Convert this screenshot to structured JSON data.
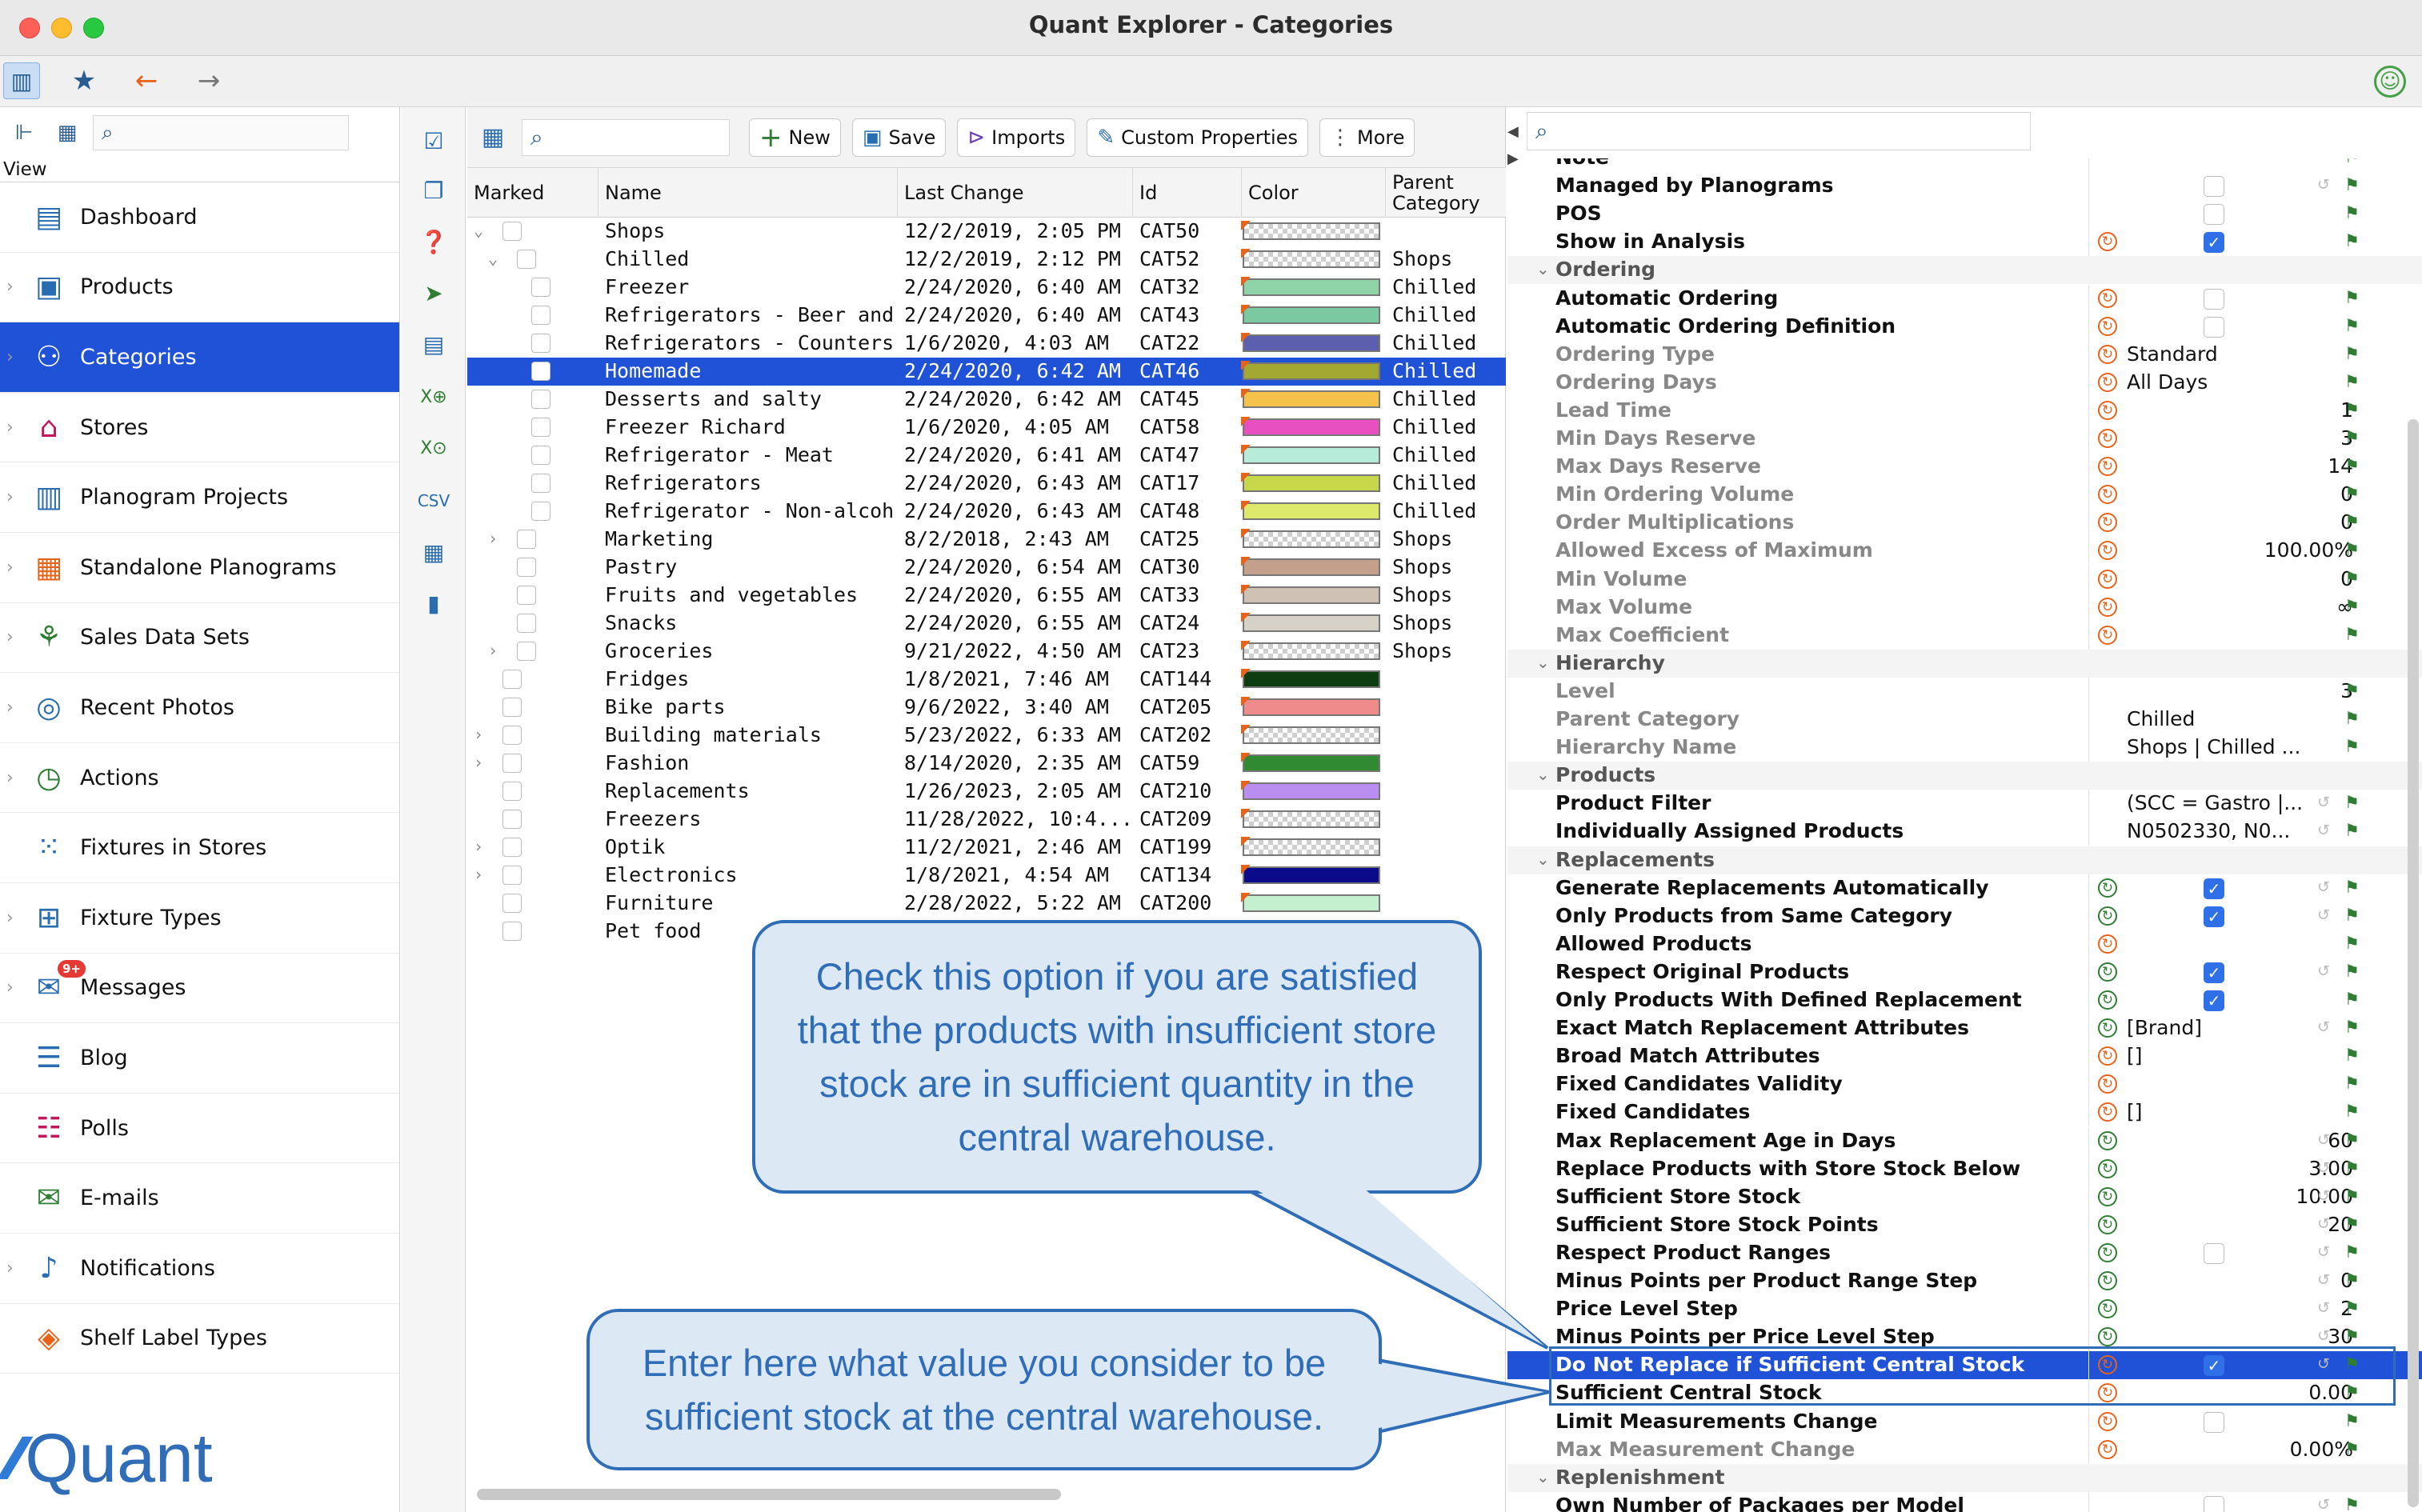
{
  "window": {
    "title": "Quant Explorer - Categories"
  },
  "sidebar": {
    "view_label": "View",
    "search_placeholder": "",
    "items": [
      {
        "label": "Dashboard",
        "icon": "dashboard-icon"
      },
      {
        "label": "Products",
        "icon": "product-icon"
      },
      {
        "label": "Categories",
        "icon": "categories-icon"
      },
      {
        "label": "Stores",
        "icon": "store-icon"
      },
      {
        "label": "Planogram Projects",
        "icon": "planogram-projects-icon"
      },
      {
        "label": "Standalone Planograms",
        "icon": "planogram-icon"
      },
      {
        "label": "Sales Data Sets",
        "icon": "sales-data-icon"
      },
      {
        "label": "Recent Photos",
        "icon": "camera-icon"
      },
      {
        "label": "Actions",
        "icon": "actions-icon"
      },
      {
        "label": "Fixtures in Stores",
        "icon": "fixtures-icon"
      },
      {
        "label": "Fixture Types",
        "icon": "fixture-types-icon"
      },
      {
        "label": "Messages",
        "icon": "messages-icon",
        "badge": "9+"
      },
      {
        "label": "Blog",
        "icon": "blog-icon"
      },
      {
        "label": "Polls",
        "icon": "polls-icon"
      },
      {
        "label": "E-mails",
        "icon": "email-icon"
      },
      {
        "label": "Notifications",
        "icon": "bell-icon"
      },
      {
        "label": "Shelf Label Types",
        "icon": "shelf-label-icon"
      }
    ],
    "brand": "Quant"
  },
  "middle": {
    "toolbar": {
      "new": "New",
      "save": "Save",
      "imports": "Imports",
      "custom_properties": "Custom Properties",
      "more": "More"
    },
    "columns": [
      "Marked",
      "Name",
      "Last Change",
      "Id",
      "Color",
      "Parent Category"
    ],
    "rows": [
      {
        "name": "Shops",
        "last_change": "12/2/2019, 2:05 PM",
        "id": "CAT50",
        "color": "checker",
        "parent": "",
        "indent": 0,
        "exp": "open"
      },
      {
        "name": "Chilled",
        "last_change": "12/2/2019, 2:12 PM",
        "id": "CAT52",
        "color": "checker",
        "parent": "Shops",
        "indent": 1,
        "exp": "open"
      },
      {
        "name": "Freezer",
        "last_change": "2/24/2020, 6:40 AM",
        "id": "CAT32",
        "color": "#8fd4a8",
        "parent": "Chilled",
        "indent": 2,
        "exp": ""
      },
      {
        "name": "Refrigerators - Beer and ci...",
        "last_change": "2/24/2020, 6:40 AM",
        "id": "CAT43",
        "color": "#7bc9a0",
        "parent": "Chilled",
        "indent": 2,
        "exp": ""
      },
      {
        "name": "Refrigerators - Counters",
        "last_change": "1/6/2020, 4:03 AM",
        "id": "CAT22",
        "color": "#5b5fae",
        "parent": "Chilled",
        "indent": 2,
        "exp": ""
      },
      {
        "name": "Homemade",
        "last_change": "2/24/2020, 6:42 AM",
        "id": "CAT46",
        "color": "#a3a832",
        "parent": "Chilled",
        "indent": 2,
        "exp": "",
        "selected": true
      },
      {
        "name": "Desserts and salty",
        "last_change": "2/24/2020, 6:42 AM",
        "id": "CAT45",
        "color": "#f5c24a",
        "parent": "Chilled",
        "indent": 2,
        "exp": ""
      },
      {
        "name": "Freezer Richard",
        "last_change": "1/6/2020, 4:05 AM",
        "id": "CAT58",
        "color": "#e84fc0",
        "parent": "Chilled",
        "indent": 2,
        "exp": ""
      },
      {
        "name": "Refrigerator - Meat",
        "last_change": "2/24/2020, 6:41 AM",
        "id": "CAT47",
        "color": "#b6ecd9",
        "parent": "Chilled",
        "indent": 2,
        "exp": ""
      },
      {
        "name": "Refrigerators",
        "last_change": "2/24/2020, 6:43 AM",
        "id": "CAT17",
        "color": "#c6d84a",
        "parent": "Chilled",
        "indent": 2,
        "exp": ""
      },
      {
        "name": "Refrigerator - Non-alcoholic",
        "last_change": "2/24/2020, 6:43 AM",
        "id": "CAT48",
        "color": "#dce96a",
        "parent": "Chilled",
        "indent": 2,
        "exp": ""
      },
      {
        "name": "Marketing",
        "last_change": "8/2/2018, 2:43 AM",
        "id": "CAT25",
        "color": "checker",
        "parent": "Shops",
        "indent": 1,
        "exp": "closed"
      },
      {
        "name": "Pastry",
        "last_change": "2/24/2020, 6:54 AM",
        "id": "CAT30",
        "color": "#c4a08c",
        "parent": "Shops",
        "indent": 1,
        "exp": ""
      },
      {
        "name": "Fruits and vegetables",
        "last_change": "2/24/2020, 6:55 AM",
        "id": "CAT33",
        "color": "#cfc1b3",
        "parent": "Shops",
        "indent": 1,
        "exp": ""
      },
      {
        "name": "Snacks",
        "last_change": "2/24/2020, 6:55 AM",
        "id": "CAT24",
        "color": "#d6d2c7",
        "parent": "Shops",
        "indent": 1,
        "exp": ""
      },
      {
        "name": "Groceries",
        "last_change": "9/21/2022, 4:50 AM",
        "id": "CAT23",
        "color": "checker",
        "parent": "Shops",
        "indent": 1,
        "exp": "closed"
      },
      {
        "name": "Fridges",
        "last_change": "1/8/2021, 7:46 AM",
        "id": "CAT144",
        "color": "#0e3d12",
        "parent": "",
        "indent": 0,
        "exp": ""
      },
      {
        "name": "Bike parts",
        "last_change": "9/6/2022, 3:40 AM",
        "id": "CAT205",
        "color": "#ef8b8b",
        "parent": "",
        "indent": 0,
        "exp": ""
      },
      {
        "name": "Building materials",
        "last_change": "5/23/2022, 6:33 AM",
        "id": "CAT202",
        "color": "checker",
        "parent": "",
        "indent": 0,
        "exp": "closed"
      },
      {
        "name": "Fashion",
        "last_change": "8/14/2020, 2:35 AM",
        "id": "CAT59",
        "color": "#2f8a32",
        "parent": "",
        "indent": 0,
        "exp": "closed"
      },
      {
        "name": "Replacements",
        "last_change": "1/26/2023, 2:05 AM",
        "id": "CAT210",
        "color": "#b98ef0",
        "parent": "",
        "indent": 0,
        "exp": ""
      },
      {
        "name": "Freezers",
        "last_change": "11/28/2022, 10:4...",
        "id": "CAT209",
        "color": "checker",
        "parent": "",
        "indent": 0,
        "exp": ""
      },
      {
        "name": "Optik",
        "last_change": "11/2/2021, 2:46 AM",
        "id": "CAT199",
        "color": "checker",
        "parent": "",
        "indent": 0,
        "exp": "closed"
      },
      {
        "name": "Electronics",
        "last_change": "1/8/2021, 4:54 AM",
        "id": "CAT134",
        "color": "#0a0a8a",
        "parent": "",
        "indent": 0,
        "exp": "closed"
      },
      {
        "name": "Furniture",
        "last_change": "2/28/2022, 5:22 AM",
        "id": "CAT200",
        "color": "#c5f0cf",
        "parent": "",
        "indent": 0,
        "exp": ""
      },
      {
        "name": "Pet food",
        "last_change": "",
        "id": "",
        "color": "",
        "parent": "",
        "indent": 0,
        "exp": ""
      }
    ]
  },
  "properties": {
    "search_placeholder": "",
    "rows": [
      {
        "type": "prop",
        "name": "Note",
        "bold": true
      },
      {
        "type": "prop",
        "name": "Managed by Planograms",
        "bold": true,
        "check": false,
        "i2": true
      },
      {
        "type": "prop",
        "name": "POS",
        "bold": true,
        "check": false
      },
      {
        "type": "prop",
        "name": "Show in Analysis",
        "bold": true,
        "icon": "orange",
        "check": true
      },
      {
        "type": "cat",
        "name": "Ordering"
      },
      {
        "type": "prop",
        "name": "Automatic Ordering",
        "bold": true,
        "icon": "orange",
        "check": false
      },
      {
        "type": "prop",
        "name": "Automatic Ordering Definition",
        "bold": true,
        "icon": "orange",
        "check": false
      },
      {
        "type": "prop",
        "name": "Ordering Type",
        "dim": true,
        "icon": "orange",
        "value": "Standard",
        "align": "l"
      },
      {
        "type": "prop",
        "name": "Ordering Days",
        "dim": true,
        "icon": "orange",
        "value": "All Days",
        "align": "l"
      },
      {
        "type": "prop",
        "name": "Lead Time",
        "dim": true,
        "icon": "orange",
        "value": "1",
        "align": "r"
      },
      {
        "type": "prop",
        "name": "Min Days Reserve",
        "dim": true,
        "icon": "orange",
        "value": "3",
        "align": "r"
      },
      {
        "type": "prop",
        "name": "Max Days Reserve",
        "dim": true,
        "icon": "orange",
        "value": "14",
        "align": "r"
      },
      {
        "type": "prop",
        "name": "Min Ordering Volume",
        "dim": true,
        "icon": "orange",
        "value": "0",
        "align": "r"
      },
      {
        "type": "prop",
        "name": "Order Multiplications",
        "dim": true,
        "icon": "orange",
        "value": "0",
        "align": "r"
      },
      {
        "type": "prop",
        "name": "Allowed Excess of Maximum",
        "dim": true,
        "icon": "orange",
        "value": "100.00%",
        "align": "r"
      },
      {
        "type": "prop",
        "name": "Min Volume",
        "dim": true,
        "icon": "orange",
        "value": "0",
        "align": "r"
      },
      {
        "type": "prop",
        "name": "Max Volume",
        "dim": true,
        "icon": "orange",
        "value": "∞",
        "align": "r"
      },
      {
        "type": "prop",
        "name": "Max Coefficient",
        "dim": true,
        "icon": "orange"
      },
      {
        "type": "cat",
        "name": "Hierarchy"
      },
      {
        "type": "prop",
        "name": "Level",
        "dim": true,
        "value": "3",
        "align": "r"
      },
      {
        "type": "prop",
        "name": "Parent Category",
        "dim": true,
        "value": "Chilled",
        "align": "l"
      },
      {
        "type": "prop",
        "name": "Hierarchy Name",
        "dim": true,
        "value": "Shops | Chilled ...",
        "align": "l"
      },
      {
        "type": "cat",
        "name": "Products"
      },
      {
        "type": "prop",
        "name": "Product Filter",
        "bold": true,
        "value": "(SCC = Gastro |...",
        "align": "l",
        "i2": true
      },
      {
        "type": "prop",
        "name": "Individually Assigned Products",
        "bold": true,
        "value": "N0502330, N0...",
        "align": "l",
        "i2": true
      },
      {
        "type": "cat",
        "name": "Replacements"
      },
      {
        "type": "prop",
        "name": "Generate Replacements Automatically",
        "bold": true,
        "icon": "green",
        "check": true,
        "i2": true
      },
      {
        "type": "prop",
        "name": "Only Products from Same Category",
        "bold": true,
        "icon": "green",
        "check": true,
        "i2": true
      },
      {
        "type": "prop",
        "name": "Allowed Products",
        "bold": true,
        "icon": "orange"
      },
      {
        "type": "prop",
        "name": "Respect Original Products",
        "bold": true,
        "icon": "green",
        "check": true,
        "i2": true
      },
      {
        "type": "prop",
        "name": "Only Products With Defined Replacement",
        "bold": true,
        "icon": "green",
        "check": true
      },
      {
        "type": "prop",
        "name": "Exact Match Replacement Attributes",
        "bold": true,
        "icon": "green",
        "value": "[Brand]",
        "align": "l",
        "i2": true
      },
      {
        "type": "prop",
        "name": "Broad Match Attributes",
        "bold": true,
        "icon": "orange",
        "value": "[]",
        "align": "l"
      },
      {
        "type": "prop",
        "name": "Fixed Candidates Validity",
        "bold": true,
        "icon": "orange"
      },
      {
        "type": "prop",
        "name": "Fixed Candidates",
        "bold": true,
        "icon": "orange",
        "value": "[]",
        "align": "l"
      },
      {
        "type": "prop",
        "name": "Max Replacement Age in Days",
        "bold": true,
        "icon": "green",
        "value": "60",
        "align": "r",
        "i2": true
      },
      {
        "type": "prop",
        "name": "Replace Products with Store Stock Below",
        "bold": true,
        "icon": "green",
        "value": "3.00",
        "align": "r",
        "i2": true
      },
      {
        "type": "prop",
        "name": "Sufficient Store Stock",
        "bold": true,
        "icon": "green",
        "value": "10.00",
        "align": "r",
        "i2": true
      },
      {
        "type": "prop",
        "name": "Sufficient Store Stock Points",
        "bold": true,
        "icon": "green",
        "value": "20",
        "align": "r",
        "i2": true
      },
      {
        "type": "prop",
        "name": "Respect Product Ranges",
        "bold": true,
        "icon": "green",
        "check": false,
        "i2": true
      },
      {
        "type": "prop",
        "name": "Minus Points per Product Range Step",
        "bold": true,
        "icon": "green",
        "value": "0",
        "align": "r",
        "i2": true
      },
      {
        "type": "prop",
        "name": "Price Level Step",
        "bold": true,
        "icon": "green",
        "value": "2",
        "align": "r",
        "i2": true
      },
      {
        "type": "prop",
        "name": "Minus Points per Price Level Step",
        "bold": true,
        "icon": "green",
        "value": "30",
        "align": "r",
        "i2": true
      },
      {
        "type": "prop",
        "name": "Do Not Replace if Sufficient Central Stock",
        "bold": true,
        "icon": "orange",
        "check": true,
        "selected": true,
        "i2": true
      },
      {
        "type": "prop",
        "name": "Sufficient Central Stock",
        "bold": true,
        "icon": "orange",
        "value": "0.00",
        "align": "r"
      },
      {
        "type": "prop",
        "name": "Limit Measurements Change",
        "bold": true,
        "icon": "orange",
        "check": false
      },
      {
        "type": "prop",
        "name": "Max Measurement Change",
        "dim": true,
        "icon": "orange",
        "value": "0.00%",
        "align": "r"
      },
      {
        "type": "cat",
        "name": "Replenishment"
      },
      {
        "type": "prop",
        "name": "Own Number of Packages per Model",
        "bold": true,
        "check": false,
        "i2": true
      }
    ]
  },
  "callouts": {
    "c1": "Check this option if you are satisfied that the products with insufficient store stock are in sufficient quantity in the central warehouse.",
    "c2": "Enter here what value you consider to be sufficient stock at the central warehouse."
  }
}
